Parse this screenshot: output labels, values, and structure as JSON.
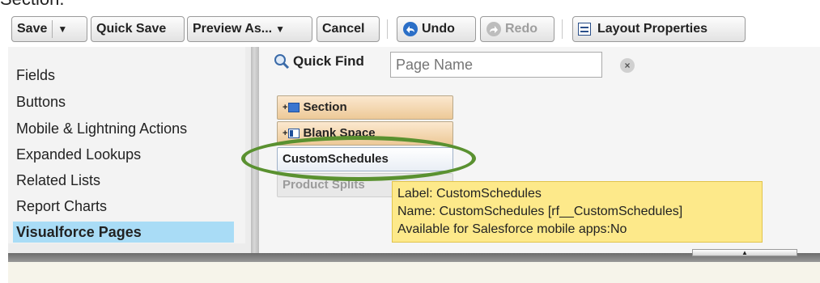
{
  "page_header_fragment": "Section.",
  "toolbar": {
    "save_label": "Save",
    "save_dropdown_arrow": "▼",
    "quick_save_label": "Quick Save",
    "preview_as_label": "Preview As...",
    "preview_dropdown_arrow": "▼",
    "cancel_label": "Cancel",
    "undo_label": "Undo",
    "redo_label": "Redo",
    "layout_properties_label": "Layout Properties"
  },
  "categories": [
    {
      "label": "Fields"
    },
    {
      "label": "Buttons"
    },
    {
      "label": "Mobile & Lightning Actions"
    },
    {
      "label": "Expanded Lookups"
    },
    {
      "label": "Related Lists"
    },
    {
      "label": "Report Charts"
    },
    {
      "label": "Visualforce Pages",
      "selected": true
    }
  ],
  "quick_find": {
    "label": "Quick Find",
    "placeholder": "Page Name",
    "clear_glyph": "×"
  },
  "palette_items": [
    {
      "label": "Section",
      "icon": "section-icon",
      "style": "tan"
    },
    {
      "label": "Blank Space",
      "icon": "blank-space-icon",
      "style": "tan"
    },
    {
      "label": "CustomSchedules",
      "style": "plain"
    },
    {
      "label": "Product Splits",
      "style": "disabled"
    }
  ],
  "tooltip": {
    "line1": "Label: CustomSchedules",
    "line2": "Name: CustomSchedules [rf__CustomSchedules]",
    "line3": "Available for Salesforce mobile apps:No"
  },
  "colors": {
    "selected_category": "#a9dcf6",
    "highlight_ring": "#5a9130",
    "tooltip_bg": "#fde98a",
    "field_tan": "#edc997"
  }
}
